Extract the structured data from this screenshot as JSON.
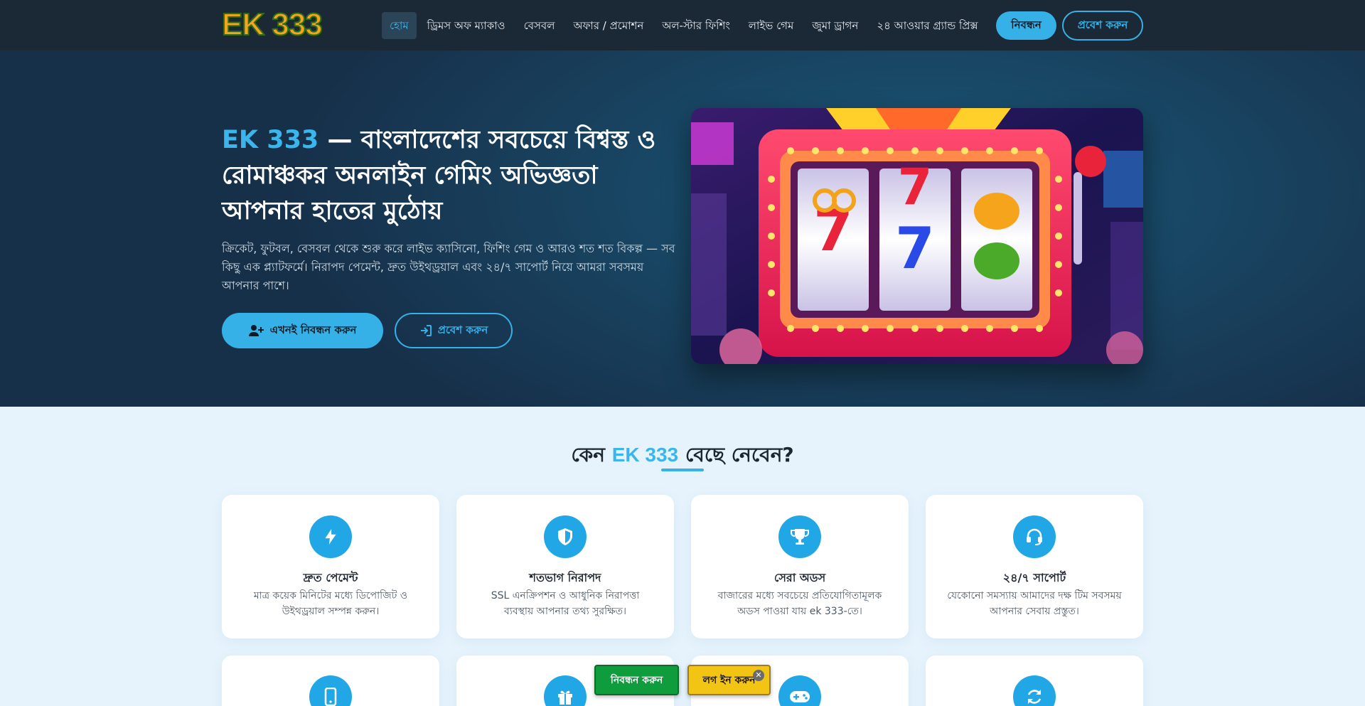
{
  "header": {
    "logo": "EK 333",
    "nav": [
      "হোম",
      "ড্রিমস অফ ম্যাকাও",
      "বেসবল",
      "অফার / প্রমোশন",
      "অল-স্টার ফিশিং",
      "লাইভ গেম",
      "জুমা ড্রাগন",
      "২৪ আওয়ার গ্র্যান্ড প্রিক্স"
    ],
    "active_nav": "হোম",
    "register_label": "নিবন্ধন",
    "login_label": "প্রবেশ করুন"
  },
  "hero": {
    "title_accent": "EK 333",
    "title_rest": " — বাংলাদেশের সবচেয়ে বিশ্বস্ত ও রোমাঞ্চকর অনলাইন গেমিং অভিজ্ঞতা আপনার হাতের মুঠোয়",
    "subtitle": "ক্রিকেট, ফুটবল, বেসবল থেকে শুরু করে লাইভ ক্যাসিনো, ফিশিং গেম ও আরও শত শত বিকল্প — সব কিছু এক প্ল্যাটফর্মে। নিরাপদ পেমেন্ট, দ্রুত উইথড্রয়াল এবং ২৪/৭ সাপোর্ট নিয়ে আমরা সবসময় আপনার পাশে।",
    "cta_register": "এখনই নিবন্ধন করুন",
    "cta_login": "প্রবেশ করুন",
    "image_icon": "slot-machine-illustration"
  },
  "why": {
    "title_pre": "কেন ",
    "title_accent": "EK 333",
    "title_post": " বেছে নেবেন?",
    "features": [
      {
        "icon": "lightning-icon",
        "title": "দ্রুত পেমেন্ট",
        "desc": "মাত্র কয়েক মিনিটের মধ্যে ডিপোজিট ও উইথড্রয়াল সম্পন্ন করুন।"
      },
      {
        "icon": "shield-icon",
        "title": "শতভাগ নিরাপদ",
        "desc": "SSL এনক্রিপশন ও আধুনিক নিরাপত্তা ব্যবস্থায় আপনার তথ্য সুরক্ষিত।"
      },
      {
        "icon": "trophy-icon",
        "title": "সেরা অডস",
        "desc": "বাজারের মধ্যে সবচেয়ে প্রতিযোগিতামূলক অডস পাওয়া যায় ek 333-তে।"
      },
      {
        "icon": "headset-icon",
        "title": "২৪/৭ সাপোর্ট",
        "desc": "যেকোনো সমস্যায় আমাদের দক্ষ টিম সবসময় আপনার সেবায় প্রস্তুত।"
      }
    ],
    "second_row_icons": [
      "mobile-icon",
      "gift-icon",
      "gamepad-icon",
      "refresh-icon"
    ]
  },
  "floating": {
    "register_label": "নিবন্ধন করুন",
    "login_label": "লগ ইন করুন",
    "close_label": "✕"
  },
  "colors": {
    "accent": "#36b1e8",
    "header_bg": "#1b2835",
    "float_register": "#0f9c3d",
    "float_login": "#f2c414"
  }
}
